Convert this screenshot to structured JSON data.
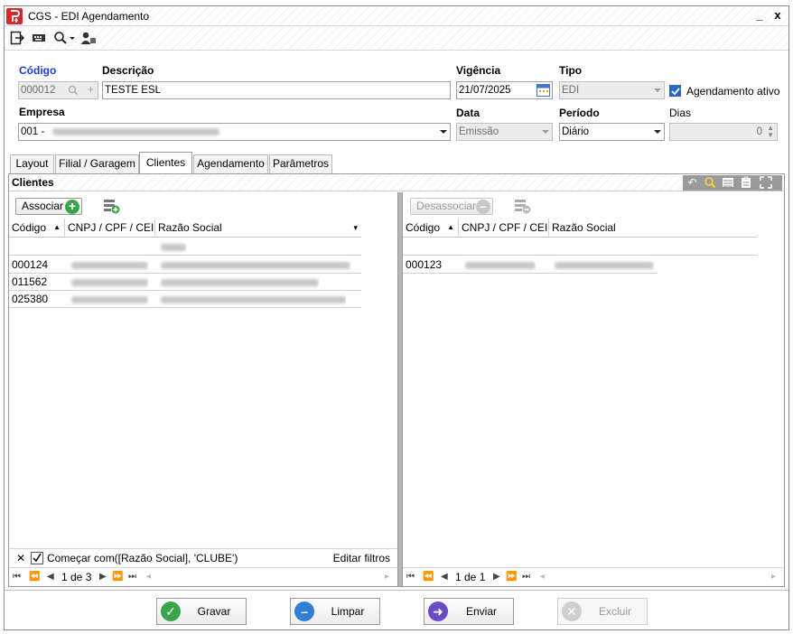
{
  "window": {
    "title": "CGS - EDI Agendamento",
    "minimize": "_",
    "close": "x"
  },
  "form": {
    "codigo_label": "Código",
    "codigo_value": "000012",
    "descricao_label": "Descrição",
    "descricao_value": "TESTE ESL",
    "vigencia_label": "Vigência",
    "vigencia_value": "21/07/2025",
    "tipo_label": "Tipo",
    "tipo_value": "EDI",
    "agendamento_ativo_label": "Agendamento ativo",
    "agendamento_ativo_checked": true,
    "empresa_label": "Empresa",
    "empresa_value": "001 -",
    "data_label": "Data",
    "data_value": "Emissão",
    "periodo_label": "Período",
    "periodo_value": "Diário",
    "dias_label": "Dias",
    "dias_value": "0"
  },
  "tabs": [
    {
      "label": "Layout"
    },
    {
      "label": "Filial / Garagem"
    },
    {
      "label": "Clientes",
      "active": true
    },
    {
      "label": "Agendamento"
    },
    {
      "label": "Parâmetros"
    }
  ],
  "clientes": {
    "title": "Clientes",
    "left": {
      "button": "Associar",
      "columns": [
        "Código",
        "CNPJ / CPF / CEI",
        "Razão Social"
      ],
      "filter_row_hint": "CLUBE",
      "rows": [
        {
          "codigo": "000124"
        },
        {
          "codigo": "011562"
        },
        {
          "codigo": "025380"
        }
      ],
      "filter_text": "Começar com([Razão Social], 'CLUBE')",
      "edit_filters": "Editar filtros",
      "pager": "1 de 3"
    },
    "right": {
      "button": "Desassociar",
      "columns": [
        "Código",
        "CNPJ / CPF / CEI",
        "Razão Social"
      ],
      "rows": [
        {
          "codigo": "000123"
        }
      ],
      "pager": "1 de 1"
    }
  },
  "footer": {
    "gravar": "Gravar",
    "limpar": "Limpar",
    "enviar": "Enviar",
    "excluir": "Excluir"
  },
  "colors": {
    "accent_blue": "#1a3ed6",
    "logo_red": "#d9262c",
    "add_green": "#3aa64c",
    "remove_blue": "#2f7fd4",
    "send_purple": "#6a4bc4"
  }
}
